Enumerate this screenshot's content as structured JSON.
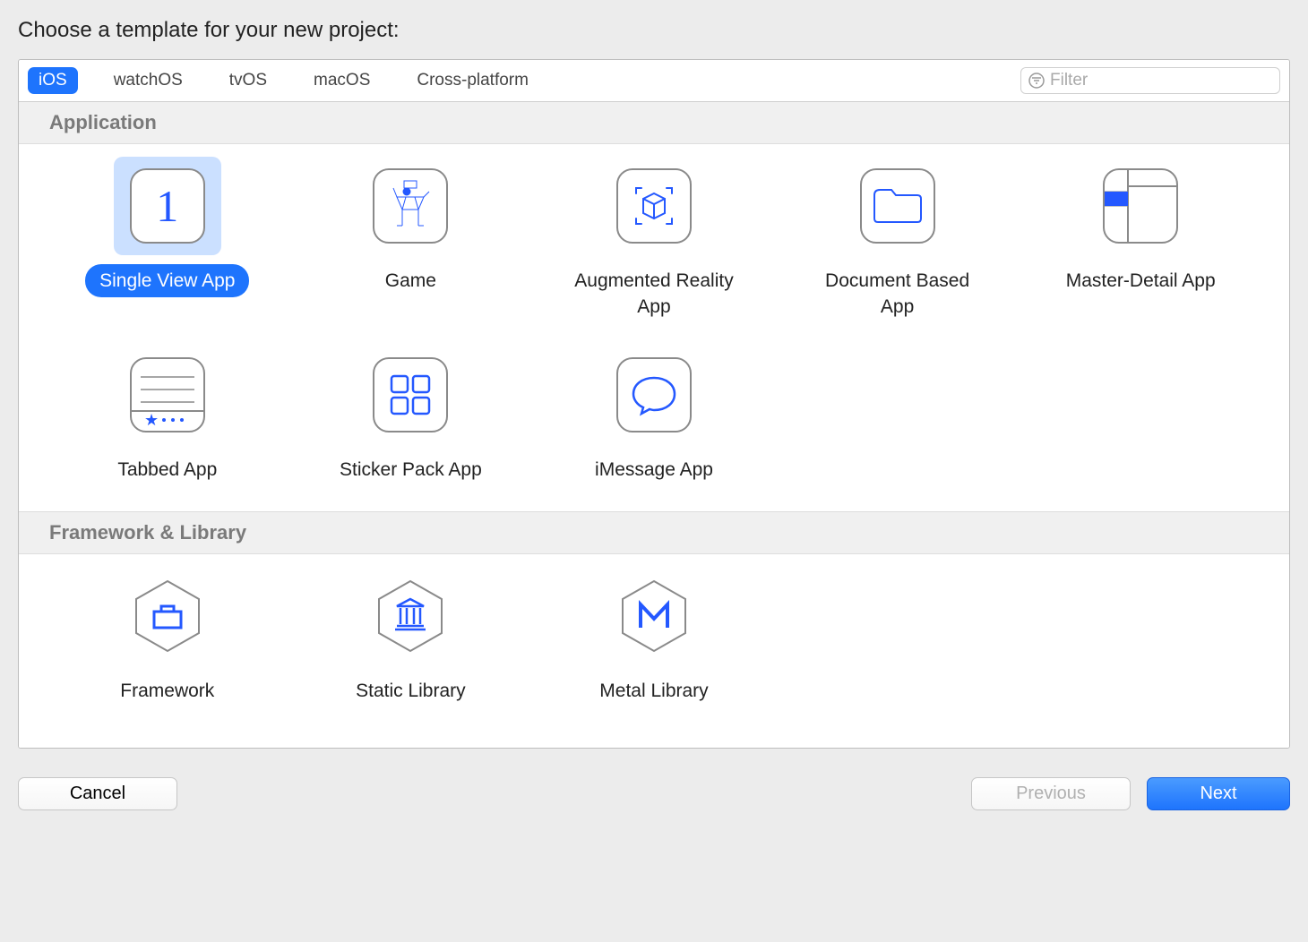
{
  "title": "Choose a template for your new project:",
  "platforms": [
    "iOS",
    "watchOS",
    "tvOS",
    "macOS",
    "Cross-platform"
  ],
  "selected_platform": 0,
  "filter_placeholder": "Filter",
  "sections": {
    "application": "Application",
    "framework": "Framework & Library"
  },
  "templates": {
    "app": [
      {
        "label": "Single View App",
        "icon": "single-view"
      },
      {
        "label": "Game",
        "icon": "game"
      },
      {
        "label": "Augmented Reality App",
        "icon": "ar"
      },
      {
        "label": "Document Based App",
        "icon": "folder"
      },
      {
        "label": "Master-Detail App",
        "icon": "master-detail"
      },
      {
        "label": "Tabbed App",
        "icon": "tabbed"
      },
      {
        "label": "Sticker Pack App",
        "icon": "sticker"
      },
      {
        "label": "iMessage App",
        "icon": "imessage"
      }
    ],
    "fw": [
      {
        "label": "Framework",
        "icon": "framework"
      },
      {
        "label": "Static Library",
        "icon": "static-lib"
      },
      {
        "label": "Metal Library",
        "icon": "metal-lib"
      }
    ]
  },
  "selected_template": "Single View App",
  "buttons": {
    "cancel": "Cancel",
    "previous": "Previous",
    "next": "Next"
  }
}
